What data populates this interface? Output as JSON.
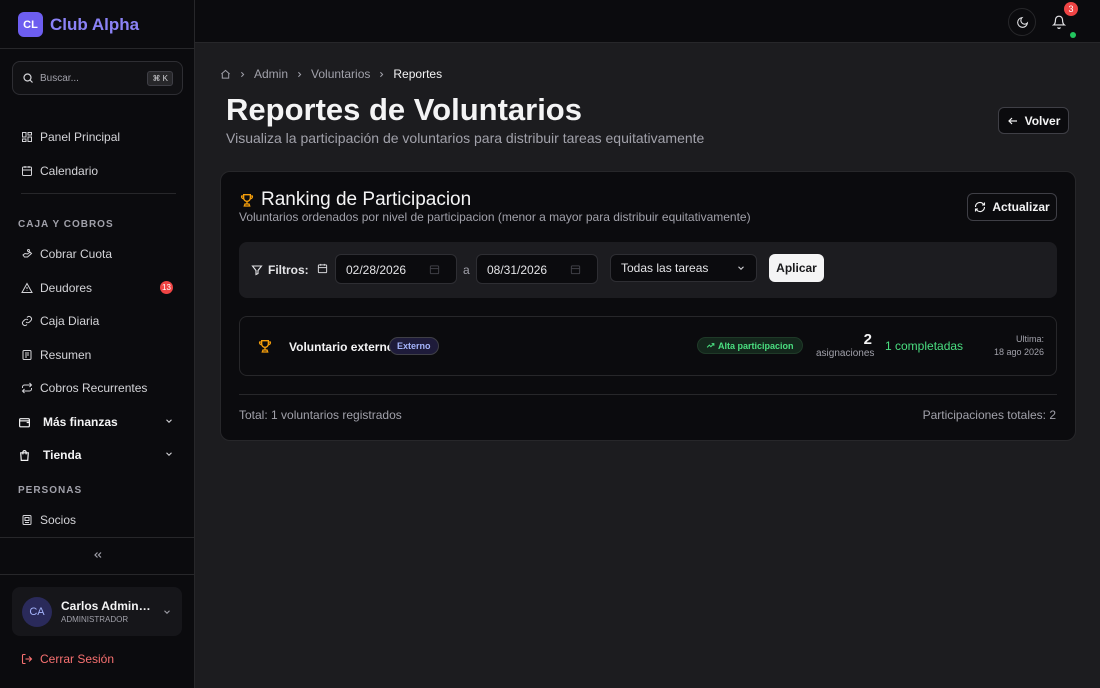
{
  "brand": {
    "logo": "CL",
    "name": "Club Alpha"
  },
  "search": {
    "placeholder": "Buscar...",
    "shortcut": "⌘ K"
  },
  "sidebar": {
    "items_top": [
      {
        "label": "Panel Principal",
        "icon": "dashboard-icon"
      },
      {
        "label": "Calendario",
        "icon": "calendar-icon"
      }
    ],
    "section_caja": "CAJA Y COBROS",
    "items_caja": [
      {
        "label": "Cobrar Cuota",
        "icon": "hand-coins-icon"
      },
      {
        "label": "Deudores",
        "icon": "alert-triangle-icon",
        "badge": "13"
      },
      {
        "label": "Caja Diaria",
        "icon": "link-icon"
      },
      {
        "label": "Resumen",
        "icon": "receipt-icon"
      },
      {
        "label": "Cobros Recurrentes",
        "icon": "repeat-icon"
      }
    ],
    "groups": [
      {
        "label": "Más finanzas",
        "icon": "wallet-icon"
      },
      {
        "label": "Tienda",
        "icon": "shopping-bag-icon"
      }
    ],
    "section_personas": "PERSONAS",
    "items_personas": [
      {
        "label": "Socios",
        "icon": "id-card-icon"
      }
    ]
  },
  "user": {
    "initials": "CA",
    "name": "Carlos Administrador",
    "role": "ADMINISTRADOR"
  },
  "logout_label": "Cerrar Sesión",
  "topbar": {
    "notifications_count": "3"
  },
  "breadcrumb": [
    "Admin",
    "Voluntarios",
    "Reportes"
  ],
  "page": {
    "title": "Reportes de Voluntarios",
    "subtitle": "Visualiza la participación de voluntarios para distribuir tareas equitativamente",
    "back_label": "Volver"
  },
  "ranking": {
    "title": "Ranking de Participacion",
    "subtitle": "Voluntarios ordenados por nivel de participacion (menor a mayor para distribuir equitativamente)",
    "refresh_label": "Actualizar",
    "filters": {
      "label": "Filtros:",
      "date_from": "02/28/2026",
      "separator": "a",
      "date_to": "08/31/2026",
      "task_select": "Todas las tareas",
      "apply_label": "Aplicar"
    },
    "rows": [
      {
        "name": "Voluntario externo",
        "tag": "Externo",
        "level": "Alta participacion",
        "count": "2",
        "count_label": "asignaciones",
        "completed": "1 completadas",
        "last_label": "Ultima:",
        "last_date": "18 ago 2026"
      }
    ],
    "total_left": "Total: 1 voluntarios registrados",
    "total_right": "Participaciones totales: 2"
  },
  "colors": {
    "accent": "#6d5ef0",
    "brand_text": "#8b82f6",
    "success": "#4ade80",
    "danger": "#ef4444"
  }
}
